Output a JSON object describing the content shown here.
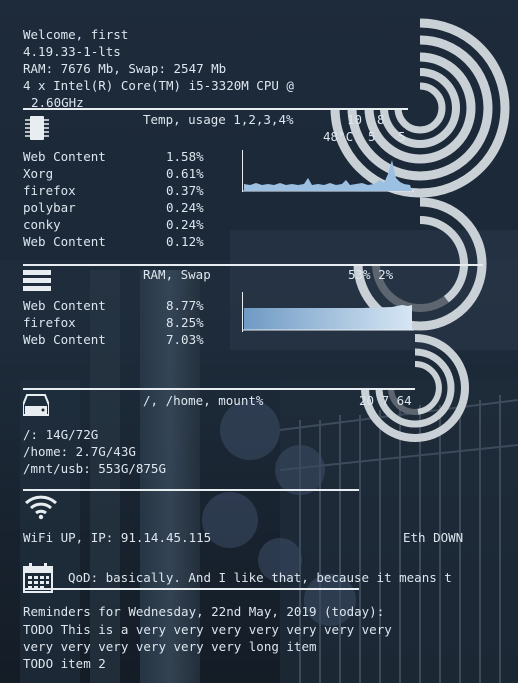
{
  "header": {
    "welcome": "Welcome, first",
    "kernel": "4.19.33-1-lts",
    "memory": "RAM: 7676 Mb, Swap: 2547 Mb",
    "cpu_line1": "4 x Intel(R) Core(TM) i5-3320M CPU @",
    "cpu_line2": "2.60GHz"
  },
  "cpu": {
    "title": "Temp, usage 1,2,3,4%",
    "cores": [
      "10",
      "8"
    ],
    "temp": "48°C",
    "core3": "5",
    "core4": "5",
    "processes": [
      {
        "name": "Web Content",
        "value": "1.58%"
      },
      {
        "name": "Xorg",
        "value": "0.61%"
      },
      {
        "name": "firefox",
        "value": "0.37%"
      },
      {
        "name": "polybar",
        "value": "0.24%"
      },
      {
        "name": "conky",
        "value": "0.24%"
      },
      {
        "name": "Web Content",
        "value": "0.12%"
      }
    ]
  },
  "ram": {
    "title": "RAM, Swap",
    "usage": "53% 2%",
    "processes": [
      {
        "name": "Web Content",
        "value": "8.77%"
      },
      {
        "name": "firefox",
        "value": "8.25%"
      },
      {
        "name": "Web Content",
        "value": "7.03%"
      }
    ]
  },
  "disk": {
    "title": "/, /home, mount%",
    "usage": "20 7 64",
    "mounts": [
      "/: 14G/72G",
      "/home: 2.7G/43G",
      "/mnt/usb: 553G/875G"
    ]
  },
  "net": {
    "wifi": "WiFi UP, IP: 91.14.45.115",
    "eth": "Eth DOWN"
  },
  "calendar": {
    "qod": "QoD: basically. And I like that, because it means t",
    "reminders_header": "Reminders for Wednesday, 22nd May, 2019 (today):",
    "items": [
      "TODO This is a very very very very very very very",
      "very very very very very very long item",
      "TODO item 2"
    ]
  },
  "levels": {
    "cpu_cores": [
      10,
      8,
      5,
      5
    ],
    "ram": 53,
    "swap": 2,
    "disk": [
      20,
      7,
      64
    ]
  },
  "colors": {
    "text": "#dde6ee",
    "ring_bg": "#5c6570",
    "ring_fg": "#c9d0d6",
    "graph": "#9bc0e2"
  },
  "icons": [
    "cpu-chip-icon",
    "ram-icon",
    "hdd-icon",
    "wifi-icon",
    "calendar-icon"
  ]
}
